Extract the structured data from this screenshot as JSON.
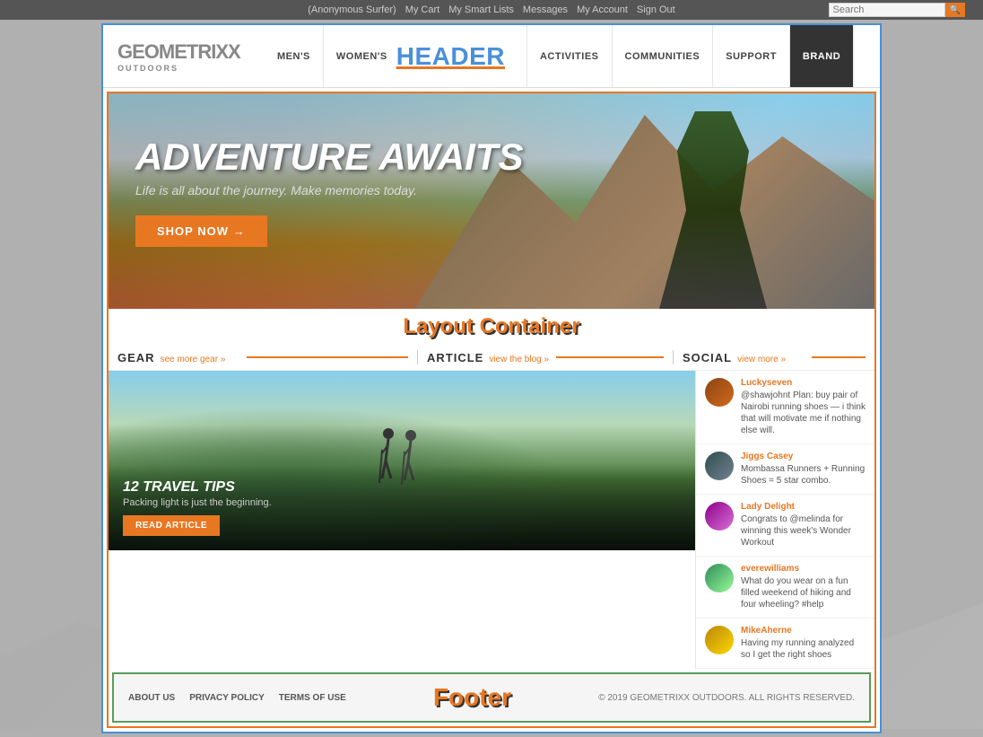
{
  "topbar": {
    "links": [
      "(Anonymous Surfer)",
      "My Cart",
      "My Smart Lists",
      "Messages",
      "My Account",
      "Sign Out"
    ],
    "search_placeholder": "Search"
  },
  "header": {
    "logo_main": "geometrixx",
    "logo_sub": "OUTDOORS",
    "label": "Header",
    "nav": [
      {
        "id": "mens",
        "label": "MEN'S"
      },
      {
        "id": "womens",
        "label": "WOMEN'S"
      },
      {
        "id": "activities",
        "label": "ACTIVITIES"
      },
      {
        "id": "communities",
        "label": "COMMUNITIES"
      },
      {
        "id": "support",
        "label": "SUPPORT"
      },
      {
        "id": "brand",
        "label": "BRAND"
      }
    ]
  },
  "hero": {
    "title": "ADVENTURE AWAITS",
    "subtitle": "Life is all about the journey. Make memories today.",
    "cta": "SHOP NOW"
  },
  "layout_label": "Layout Container",
  "sections": {
    "gear": {
      "title": "GEAR",
      "link": "see more gear »"
    },
    "article": {
      "title": "ARTICLE",
      "link": "view the blog »",
      "count": "12 TRAVEL TIPS",
      "description": "Packing light is just the beginning.",
      "cta": "READ ARTICLE"
    },
    "social": {
      "title": "SOCIAL",
      "link": "view more »",
      "items": [
        {
          "username": "Luckyseven",
          "text": "@shawjohnt Plan: buy pair of Nairobi running shoes — i think that will motivate me if nothing else will.",
          "avatar": "avatar-1"
        },
        {
          "username": "Jiggs Casey",
          "text": "Mombassa Runners + Running Shoes = 5 star combo.",
          "avatar": "avatar-2"
        },
        {
          "username": "Lady Delight",
          "text": "Congrats to @melinda for winning this week's Wonder Workout",
          "avatar": "avatar-3"
        },
        {
          "username": "everewilliams",
          "text": "What do you wear on a fun filled weekend of hiking and four wheeling? #help",
          "avatar": "avatar-4"
        },
        {
          "username": "MikeAherne",
          "text": "Having my running analyzed so I get the right shoes",
          "avatar": "avatar-5"
        }
      ]
    }
  },
  "footer": {
    "label": "Footer",
    "links": [
      "ABOUT US",
      "PRIVACY POLICY",
      "TERMS OF USE"
    ],
    "copyright": "© 2019 GEOMETRIXX OUTDOORS. ALL RIGHTS RESERVED."
  }
}
